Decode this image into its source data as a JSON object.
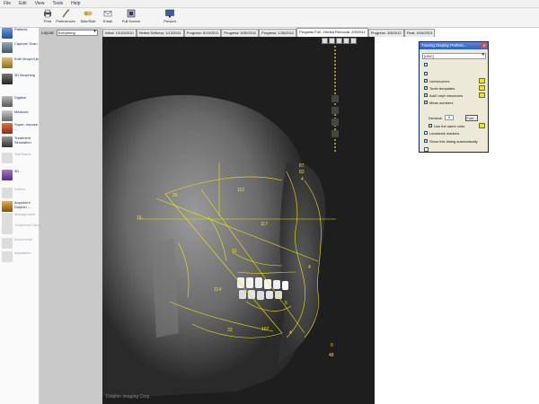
{
  "menu": {
    "items": [
      "File",
      "Edit",
      "View",
      "Tools",
      "Help"
    ]
  },
  "toolbar": {
    "buttons": [
      "Print",
      "Preferences",
      "Side/Side",
      "Email",
      "Full Screen",
      "Present"
    ]
  },
  "sidebar": {
    "items": [
      {
        "label": "Patients",
        "icon": "patients-icon",
        "enabled": true
      },
      {
        "label": "Capture/ Scan",
        "icon": "camera-icon",
        "enabled": true
      },
      {
        "label": "Edit/ Morph/Lib",
        "icon": "edit-icon",
        "enabled": true
      },
      {
        "label": "3D Morphing",
        "icon": "morph-icon",
        "enabled": true
      },
      {
        "label": "Digitize",
        "icon": "digitize-icon",
        "enabled": true
      },
      {
        "label": "Measure",
        "icon": "measure-icon",
        "enabled": true
      },
      {
        "label": "Super- impose ...",
        "icon": "superimpose-icon",
        "enabled": true
      },
      {
        "label": "Treatment Simulation",
        "icon": "treatment-icon",
        "enabled": true
      },
      {
        "label": "Sof/Tissue",
        "icon": "softtissue-icon",
        "enabled": false
      },
      {
        "label": "3D ...",
        "icon": "3d-icon",
        "enabled": true
      },
      {
        "label": "Letters",
        "icon": "letters-icon",
        "enabled": false
      },
      {
        "label": "Anywhere Dolphin ...",
        "icon": "anywhere-icon",
        "enabled": true
      },
      {
        "label": "Management",
        "icon": "management-icon",
        "enabled": false
      },
      {
        "label": "Treatment Card",
        "icon": "card-icon",
        "enabled": false
      },
      {
        "label": "Documents",
        "icon": "documents-icon",
        "enabled": false
      },
      {
        "label": "Aquasition",
        "icon": "aquasition-icon",
        "enabled": false
      }
    ]
  },
  "layout": {
    "label": "Layout:",
    "value": "Everything"
  },
  "tabs": [
    {
      "label": "Initial: 10/15/2010",
      "active": false
    },
    {
      "label": "Herbst Delivery: 1/13/2011",
      "active": false
    },
    {
      "label": "Progress: 5/19/2011",
      "active": false
    },
    {
      "label": "Progress: 6/30/2011",
      "active": false
    },
    {
      "label": "Progress: 1/26/2012",
      "active": false
    },
    {
      "label": "Progress Full - Herbst Removal: 2/9/2012",
      "active": true
    },
    {
      "label": "Progress: 3/8/2012",
      "active": false
    },
    {
      "label": "Final: 4/16/2013",
      "active": false
    }
  ],
  "xray": {
    "measurements": [
      "87",
      "83",
      "4",
      "110",
      "26",
      "117",
      "16",
      "91",
      "4",
      "114",
      "5",
      "107",
      "23",
      "4",
      "0",
      "48"
    ],
    "watermark": "Dolphin Imaging Corp."
  },
  "dialog": {
    "title": "Tracing Display Prefere...",
    "preset": "[UNC]",
    "options": [
      {
        "label": "Lines/curves",
        "checked": true,
        "swatch": "#f2e600"
      },
      {
        "label": "Tooth templates",
        "checked": true,
        "swatch": "#f2e600"
      },
      {
        "label": "Add'l ceph structures",
        "checked": true,
        "swatch": "#f2e600"
      },
      {
        "label": "Meas numbers",
        "checked": true,
        "swatch": null
      }
    ],
    "decimal_label": "Decimal:",
    "decimal_value": "0",
    "font_button": "Font...",
    "use_same_color": {
      "label": "Use the same color",
      "checked": true,
      "swatch": "#f2e600"
    },
    "landmark_markers": {
      "label": "Landmark markers",
      "checked": false
    },
    "show_automatically": {
      "label": "Show this dialog automatically",
      "checked": true
    }
  },
  "colors": {
    "tracing": "#f2e600",
    "dialog_title": "#2c5fc0",
    "sidebar_text": "#1a2d6e"
  }
}
